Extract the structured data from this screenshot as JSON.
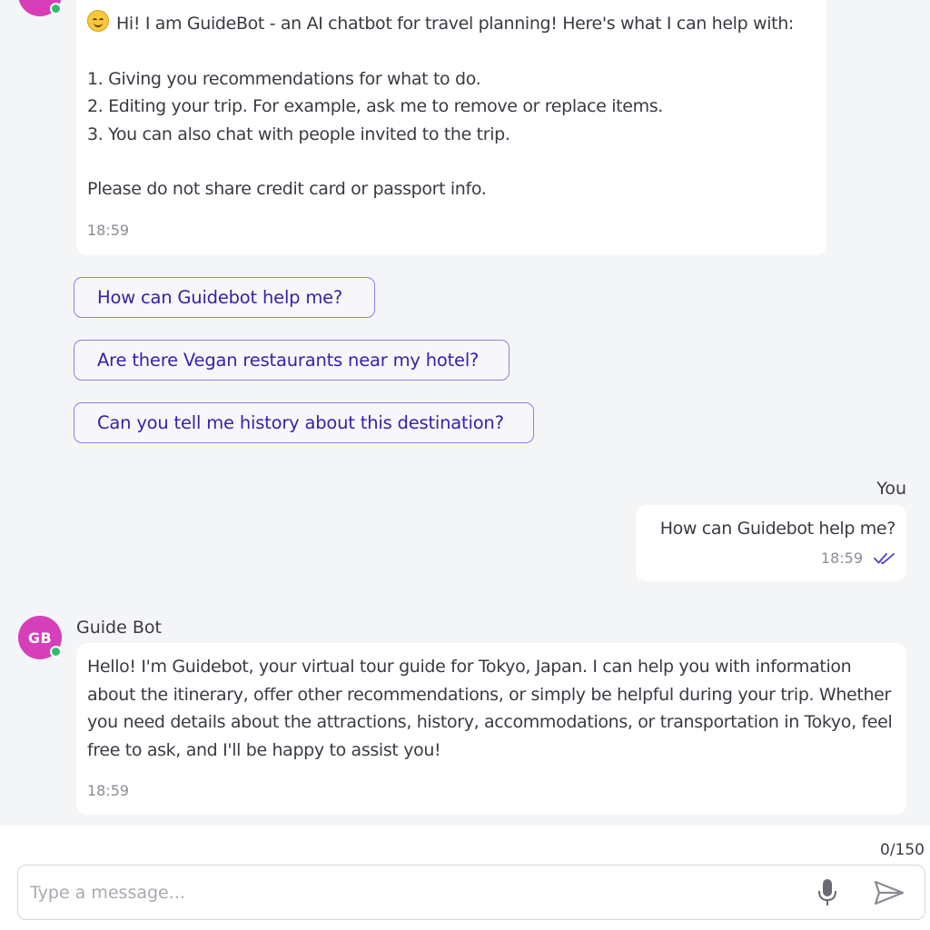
{
  "intro_message": {
    "avatar_icon": "bot-avatar",
    "emoji_icon": "smiling-face-icon",
    "greeting": "Hi! I am GuideBot - an AI chatbot for travel planning! Here's what I can help with:",
    "items": [
      "1. Giving you recommendations for what to do.",
      "2. Editing your trip. For example, ask me to remove or replace items.",
      "3. You can also chat with people invited to the trip."
    ],
    "notice": "Please do not share credit card or passport info.",
    "time": "18:59"
  },
  "suggestions": [
    "How can Guidebot help me?",
    "Are there Vegan restaurants near my hotel?",
    "Can you tell me history about this destination?"
  ],
  "user_message": {
    "sender": "You",
    "text": "How can Guidebot help me?",
    "time": "18:59",
    "status_icon": "double-check-icon"
  },
  "bot_reply": {
    "avatar_initials": "GB",
    "sender": "Guide Bot",
    "text": "Hello! I'm Guidebot, your virtual tour guide for Tokyo, Japan. I can help you with information about the itinerary, offer other recommendations, or simply be helpful during your trip. Whether you need details about the attractions, history, accommodations, or transportation in Tokyo, feel free to ask, and I'll be happy to assist you!",
    "time": "18:59"
  },
  "composer": {
    "char_count": "0/150",
    "placeholder": "Type a message...",
    "mic_icon": "microphone-icon",
    "send_icon": "send-icon"
  },
  "colors": {
    "background": "#f4f5f7",
    "avatar": "#d63fb9",
    "online": "#2ebd6b",
    "chip_text": "#3523a8",
    "chip_border": "#8f7ee3",
    "read_receipt": "#4b3fcf"
  }
}
